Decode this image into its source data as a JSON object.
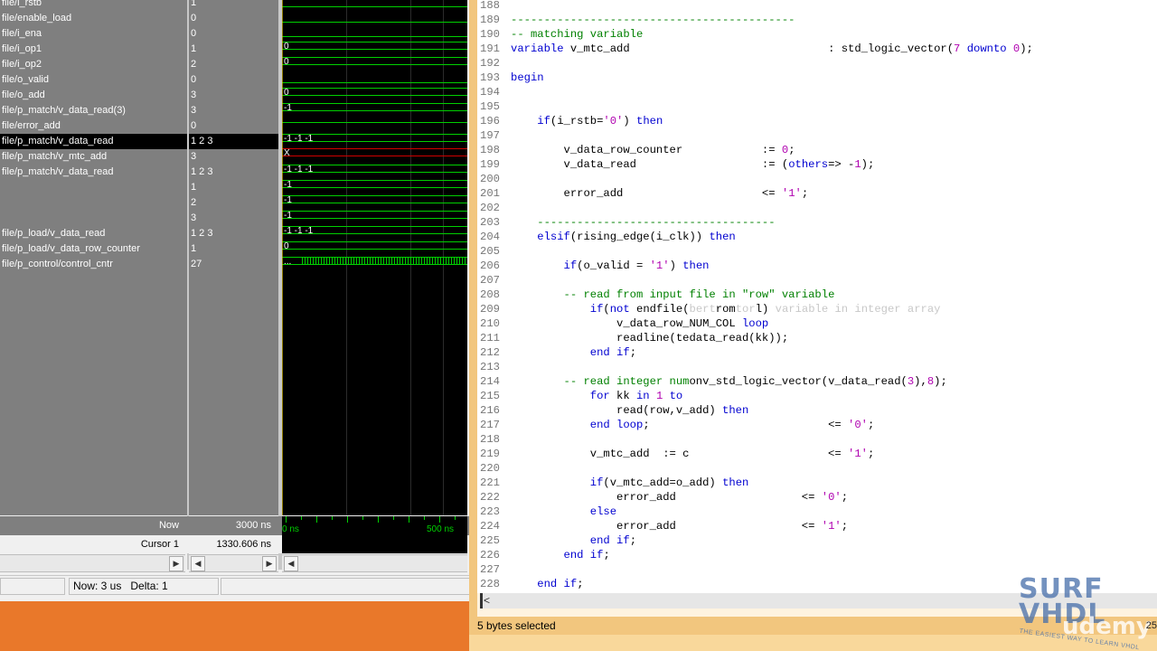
{
  "wave": {
    "signals": [
      {
        "name": "file/i_rstb",
        "value": "1"
      },
      {
        "name": "file/enable_load",
        "value": "0"
      },
      {
        "name": "file/i_ena",
        "value": "0"
      },
      {
        "name": "file/i_op1",
        "value": "1"
      },
      {
        "name": "file/i_op2",
        "value": "2"
      },
      {
        "name": "file/o_valid",
        "value": "0"
      },
      {
        "name": "file/o_add",
        "value": "3"
      },
      {
        "name": "file/p_match/v_data_read(3)",
        "value": "3"
      },
      {
        "name": "file/error_add",
        "value": "0"
      },
      {
        "name": "file/p_match/v_data_read",
        "value": "1 2 3"
      },
      {
        "name": "file/p_match/v_mtc_add",
        "value": "3"
      },
      {
        "name": "file/p_match/v_data_read",
        "value": "1 2 3"
      },
      {
        "name": "",
        "value": "1"
      },
      {
        "name": "",
        "value": "2"
      },
      {
        "name": "",
        "value": "3"
      },
      {
        "name": "file/p_load/v_data_read",
        "value": "1 2 3"
      },
      {
        "name": "file/p_load/v_data_row_counter",
        "value": "1"
      },
      {
        "name": "file/p_control/control_cntr",
        "value": "27"
      }
    ],
    "wave_labels": [
      "0",
      "0",
      "0",
      "-1",
      "-1 -1 -1",
      "X",
      "-1 -1 -1",
      "-1",
      "-1",
      "-1",
      "-1 -1 -1",
      "0",
      "..."
    ],
    "now_label": "Now",
    "now_value": "3000 ns",
    "cursor_label": "Cursor 1",
    "cursor_value": "1330.606 ns",
    "axis_start": "0 ns",
    "axis_mid": "500 ns",
    "status_now": "Now: 3 us",
    "status_delta": "Delta: 1"
  },
  "editor": {
    "lines": [
      {
        "n": "188",
        "html": ""
      },
      {
        "n": "189",
        "html": "<span class='cm'>-------------------------------------------</span>"
      },
      {
        "n": "190",
        "html": "<span class='cm'>-- matching variable</span>"
      },
      {
        "n": "191",
        "html": "<span class='kw'>variable</span> v_mtc_add                              : std_logic_vector(<span class='st'>7</span> <span class='kw'>downto</span> <span class='st'>0</span>);"
      },
      {
        "n": "192",
        "html": ""
      },
      {
        "n": "193",
        "html": "<span class='kw'>begin</span>"
      },
      {
        "n": "194",
        "html": ""
      },
      {
        "n": "195",
        "html": ""
      },
      {
        "n": "196",
        "html": "    <span class='kw'>if</span>(i_rstb=<span class='st'>'0'</span>) <span class='kw'>then</span>"
      },
      {
        "n": "197",
        "html": ""
      },
      {
        "n": "198",
        "html": "        v_data_row_counter            := <span class='st'>0</span>;"
      },
      {
        "n": "199",
        "html": "        v_data_read                   := (<span class='kw'>others</span>=&gt; -<span class='st'>1</span>);"
      },
      {
        "n": "200",
        "html": ""
      },
      {
        "n": "201",
        "html": "        error_add                     &lt;= <span class='st'>'1'</span>;"
      },
      {
        "n": "202",
        "html": ""
      },
      {
        "n": "203",
        "html": "    <span class='cm'>------------------------------------</span>"
      },
      {
        "n": "204",
        "html": "    <span class='kw'>elsif</span>(rising_edge(i_clk)) <span class='kw'>then</span>"
      },
      {
        "n": "205",
        "html": ""
      },
      {
        "n": "206",
        "html": "        <span class='kw'>if</span>(o_valid = <span class='st'>'1'</span>) <span class='kw'>then</span>"
      },
      {
        "n": "207",
        "html": ""
      },
      {
        "n": "208",
        "html": "        <span class='cm'>-- read from input file in \"row\" variable</span>"
      },
      {
        "n": "209",
        "html": "            <span class='kw'>if</span>(<span class='kw'>not</span> endfile(<span class='ghost'>bert</span>rom<span class='ghost'>tor</span>l) <span class='ghost'>variable in integer array</span>"
      },
      {
        "n": "210",
        "html": "                v_data_row_NUM_COL <span class='kw'>loop</span>"
      },
      {
        "n": "211",
        "html": "                readline(tedata_read(kk));"
      },
      {
        "n": "212",
        "html": "            <span class='kw'>end</span> <span class='kw'>if</span>;"
      },
      {
        "n": "213",
        "html": ""
      },
      {
        "n": "214",
        "html": "        <span class='cm'>-- read integer num</span>onv_std_logic_vector(v_data_read(<span class='st'>3</span>),<span class='st'>8</span>);"
      },
      {
        "n": "215",
        "html": "            <span class='kw'>for</span> kk <span class='kw'>in</span> <span class='st'>1</span> <span class='kw'>to</span>"
      },
      {
        "n": "216",
        "html": "                read(row,v_add) <span class='kw'>then</span>"
      },
      {
        "n": "217",
        "html": "            <span class='kw'>end</span> <span class='kw'>loop</span>;                           &lt;= <span class='st'>'0'</span>;"
      },
      {
        "n": "218",
        "html": ""
      },
      {
        "n": "219",
        "html": "            v_mtc_add  := c                     &lt;= <span class='st'>'1'</span>;"
      },
      {
        "n": "220",
        "html": ""
      },
      {
        "n": "221",
        "html": "            <span class='kw'>if</span>(v_mtc_add=o_add) <span class='kw'>then</span>"
      },
      {
        "n": "222",
        "html": "                error_add                   &lt;= <span class='st'>'0'</span>;"
      },
      {
        "n": "223",
        "html": "            <span class='kw'>else</span>"
      },
      {
        "n": "224",
        "html": "                error_add                   &lt;= <span class='st'>'1'</span>;"
      },
      {
        "n": "225",
        "html": "            <span class='kw'>end</span> <span class='kw'>if</span>;"
      },
      {
        "n": "226",
        "html": "        <span class='kw'>end</span> <span class='kw'>if</span>;"
      },
      {
        "n": "227",
        "html": ""
      },
      {
        "n": "228",
        "html": "    <span class='kw'>end</span> <span class='kw'>if</span>;"
      }
    ],
    "status": "5 bytes selected"
  },
  "logo": {
    "surf": "SURF",
    "vhdl": "VHDL",
    "udemy": "udemy",
    "tagline": "THE EASIEST WAY TO LEARN VHDL",
    "corner_num": "25"
  },
  "colors": {
    "trace_green": "#00d000",
    "trace_red": "#d00000",
    "keyword": "#0000d0",
    "comment": "#008000",
    "literal": "#b000b0",
    "desktop_orange": "#e9782a"
  }
}
